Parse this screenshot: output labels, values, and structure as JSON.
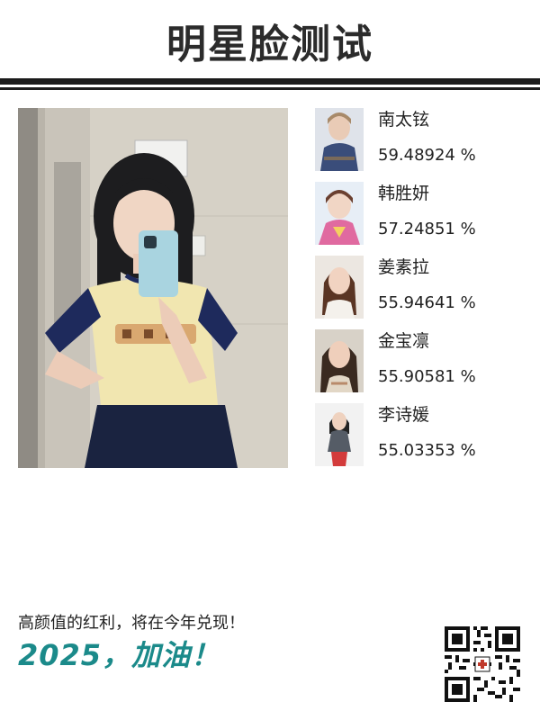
{
  "header": {
    "title": "明星脸测试"
  },
  "photo": {
    "icon": "user-selfie-photo"
  },
  "matches": [
    {
      "name": "南太铉",
      "score": "59.48924 %"
    },
    {
      "name": "韩胜妍",
      "score": "57.24851 %"
    },
    {
      "name": "姜素拉",
      "score": "55.94641 %"
    },
    {
      "name": "金宝凛",
      "score": "55.90581 %"
    },
    {
      "name": "李诗媛",
      "score": "55.03353 %"
    }
  ],
  "footer": {
    "slogan": "高颜值的红利，将在今年兑现！",
    "slogan_big": "2025，加油！",
    "qr_icon": "qr-code-icon"
  },
  "colors": {
    "accent": "#1b8a8a",
    "text": "#222222",
    "rule": "#1a1a1a"
  }
}
